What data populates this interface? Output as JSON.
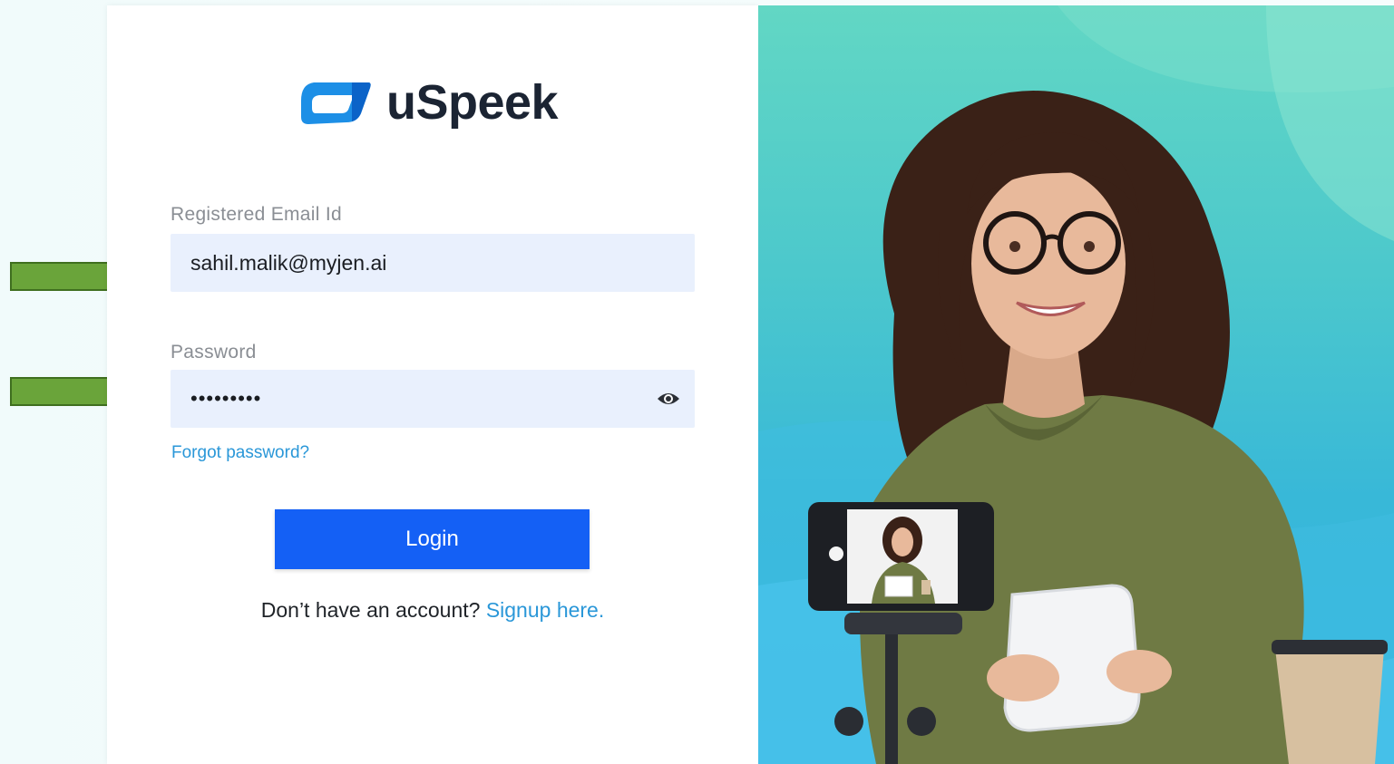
{
  "brand": {
    "name": "uSpeek",
    "logo_icon": "speech-bubble-logo-icon",
    "logo_colors": [
      "#2196e8",
      "#0d6fd0"
    ]
  },
  "form": {
    "email": {
      "label": "Registered Email Id",
      "value": "sahil.malik@myjen.ai"
    },
    "password": {
      "label": "Password",
      "value": "•••••••••",
      "toggle_icon": "eye-icon"
    },
    "forgot_password": "Forgot password?",
    "login_button": "Login",
    "signup_prompt": "Don’t have an account?",
    "signup_link": "Signup here."
  },
  "annotations": {
    "arrow_icon": "right-arrow-icon",
    "arrow_color": "#6aa43a"
  },
  "colors": {
    "primary_button": "#1460f5",
    "link": "#2a97d8",
    "field_background": "#e9f0fd"
  }
}
